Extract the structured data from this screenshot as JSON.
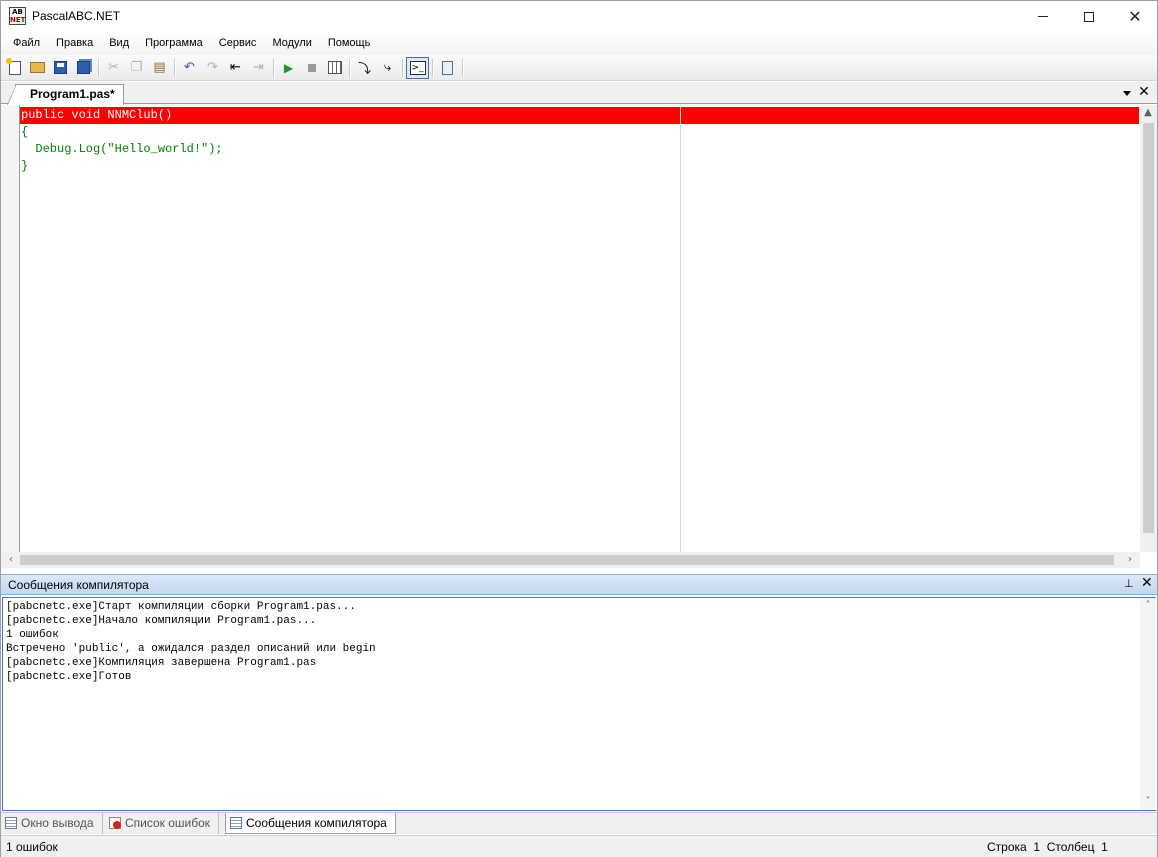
{
  "window": {
    "title": "PascalABC.NET",
    "icon_top": "AB",
    "icon_bottom": "NET"
  },
  "menu": [
    "Файл",
    "Правка",
    "Вид",
    "Программа",
    "Сервис",
    "Модули",
    "Помощь"
  ],
  "toolbar": {
    "icons": [
      "new-file-icon",
      "open-folder-icon",
      "save-icon",
      "save-all-icon",
      "cut-icon",
      "copy-icon",
      "paste-icon",
      "undo-icon",
      "redo-icon",
      "indent-icon",
      "outdent-icon",
      "run-icon",
      "stop-icon",
      "compile-icon",
      "debug-step-icon",
      "debug-step-over-icon",
      "console-icon",
      "document-icon"
    ]
  },
  "editor": {
    "tab_label": "Program1.pas*",
    "lines": [
      "public void NNMClub()",
      "{",
      "  Debug.Log(\"Hello_world!\");",
      "}"
    ],
    "error_line_color": "#ff0000"
  },
  "compiler_panel": {
    "title": "Сообщения компилятора",
    "messages": [
      "[pabcnetc.exe]Старт компиляции сборки Program1.pas...",
      "[pabcnetc.exe]Начало компиляции Program1.pas...",
      "1 ошибок",
      "Встречено 'public', а ожидался раздел описаний или begin",
      "[pabcnetc.exe]Компиляция завершена Program1.pas",
      "[pabcnetc.exe]Готов"
    ]
  },
  "bottom_tabs": [
    "Окно вывода",
    "Список ошибок",
    "Сообщения компилятора"
  ],
  "status": {
    "left": "1 ошибок",
    "row_label": "Строка",
    "row_value": "1",
    "col_label": "Столбец",
    "col_value": "1"
  }
}
